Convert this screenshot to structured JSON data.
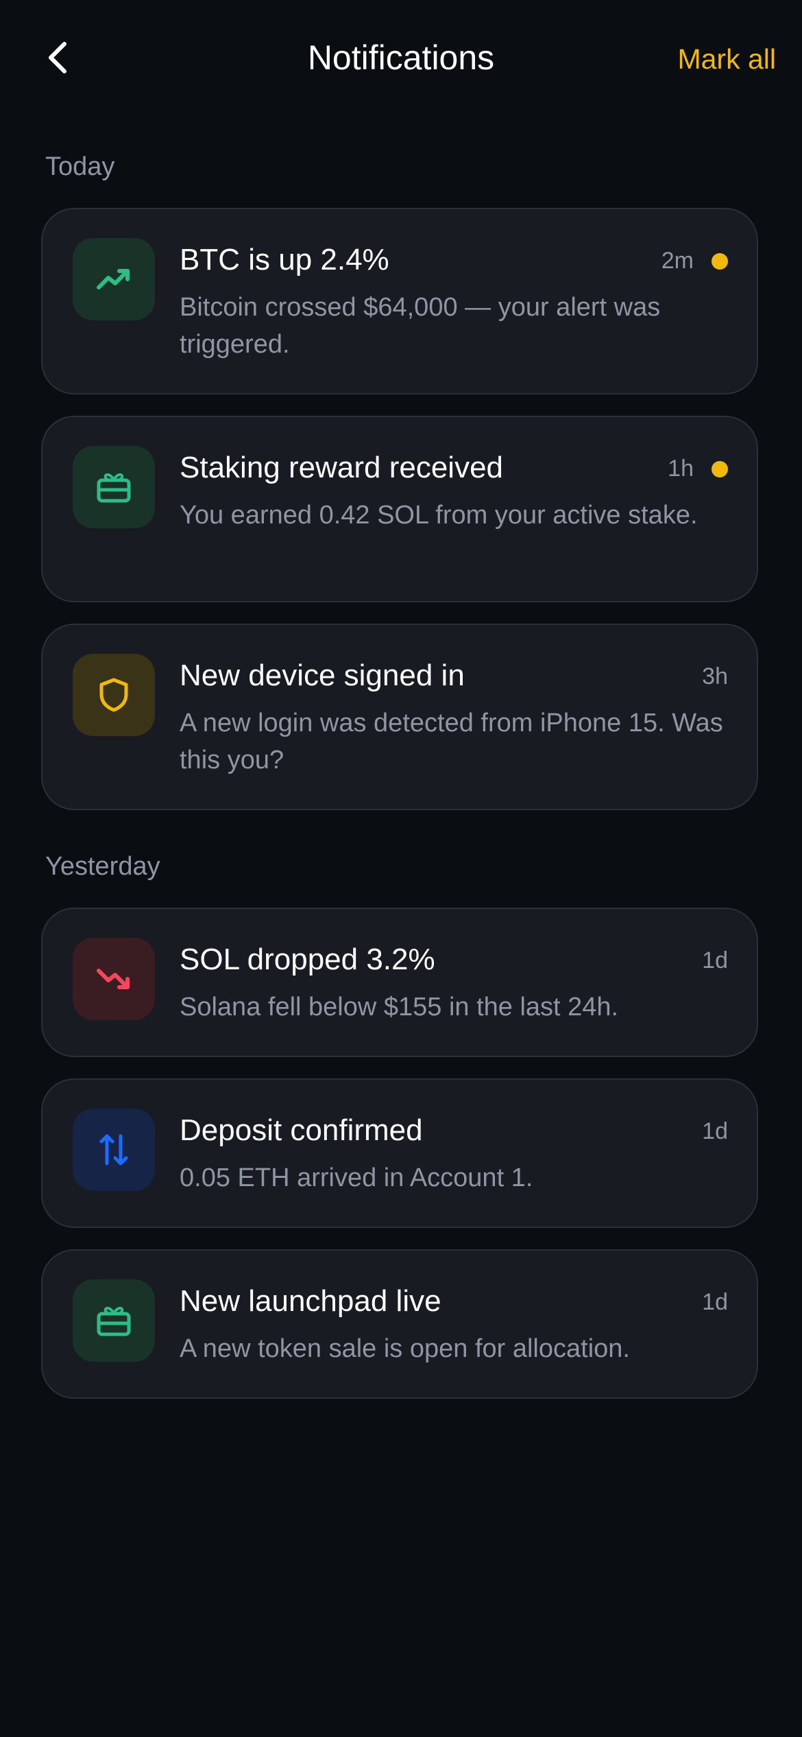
{
  "header": {
    "title": "Notifications",
    "mark_all": "Mark all"
  },
  "colors": {
    "background": "#0a0d11",
    "card": "#181b21",
    "accent": "#f0b90b",
    "green": "#2ebd85",
    "red": "#f6465d",
    "blue": "#1e6bff",
    "muted": "#8f96a3"
  },
  "sections": [
    {
      "label": "Today",
      "items": [
        {
          "icon": "trending-up-icon",
          "title": "BTC is up 2.4%",
          "time": "2m",
          "unread": true,
          "body": "Bitcoin crossed $64,000 — your alert was triggered."
        },
        {
          "icon": "gift-icon",
          "title": "Staking reward received",
          "time": "1h",
          "unread": true,
          "body": "You earned 0.42 SOL from your active stake."
        },
        {
          "icon": "shield-icon",
          "title": "New device signed in",
          "time": "3h",
          "unread": false,
          "body": "A new login was detected from iPhone 15. Was this you?"
        }
      ]
    },
    {
      "label": "Yesterday",
      "items": [
        {
          "icon": "trending-down-icon",
          "title": "SOL dropped 3.2%",
          "time": "1d",
          "unread": false,
          "body": "Solana fell below $155 in the last 24h."
        },
        {
          "icon": "transfer-icon",
          "title": "Deposit confirmed",
          "time": "1d",
          "unread": false,
          "body": "0.05 ETH arrived in Account 1."
        },
        {
          "icon": "gift-icon",
          "title": "New launchpad live",
          "time": "1d",
          "unread": false,
          "body": "A new token sale is open for allocation."
        }
      ]
    }
  ]
}
